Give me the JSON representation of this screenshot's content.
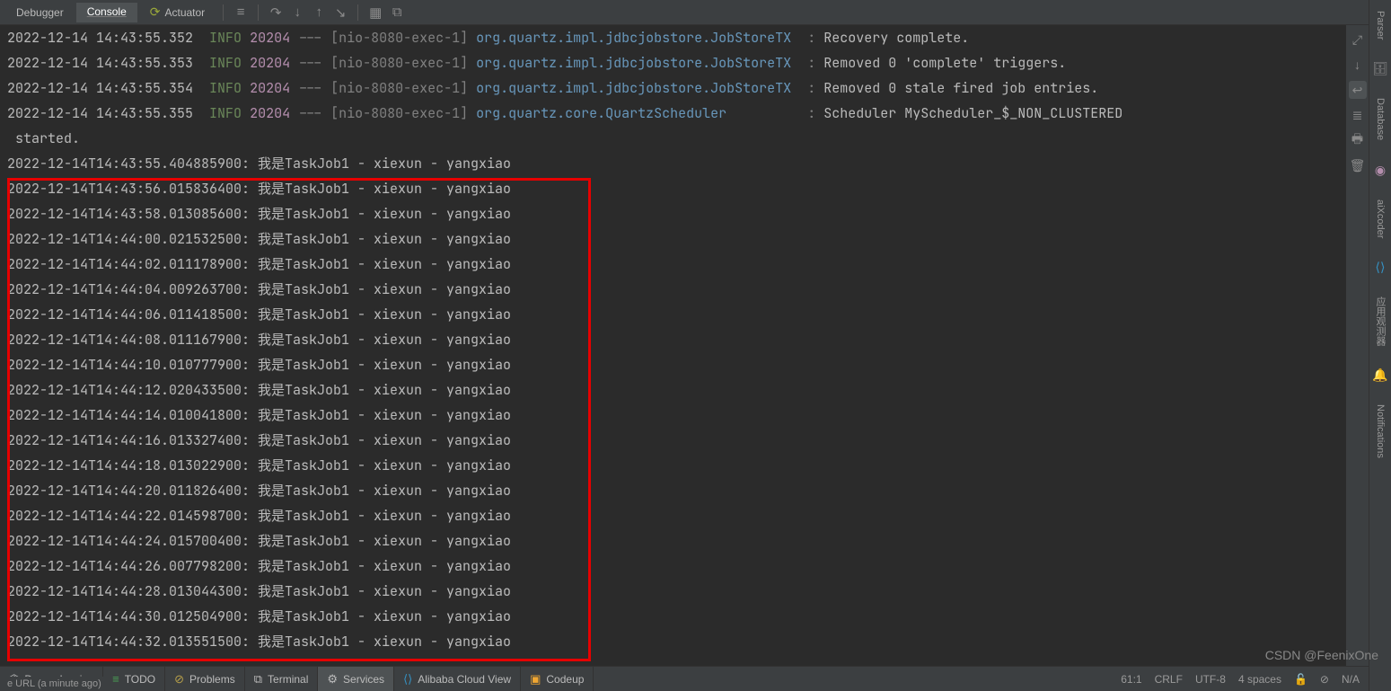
{
  "tabs": {
    "debugger": "Debugger",
    "console": "Console",
    "actuator": "Actuator"
  },
  "logs": [
    {
      "ts": "2022-12-14 14:43:55.352",
      "lvl": "INFO",
      "pid": "20204",
      "dash": "---",
      "thread": "[nio-8080-exec-1]",
      "logger": "org.quartz.impl.jdbcjobstore.JobStoreTX",
      "msg": "Recovery complete."
    },
    {
      "ts": "2022-12-14 14:43:55.353",
      "lvl": "INFO",
      "pid": "20204",
      "dash": "---",
      "thread": "[nio-8080-exec-1]",
      "logger": "org.quartz.impl.jdbcjobstore.JobStoreTX",
      "msg": "Removed 0 'complete' triggers."
    },
    {
      "ts": "2022-12-14 14:43:55.354",
      "lvl": "INFO",
      "pid": "20204",
      "dash": "---",
      "thread": "[nio-8080-exec-1]",
      "logger": "org.quartz.impl.jdbcjobstore.JobStoreTX",
      "msg": "Removed 0 stale fired job entries."
    },
    {
      "ts": "2022-12-14 14:43:55.355",
      "lvl": "INFO",
      "pid": "20204",
      "dash": "---",
      "thread": "[nio-8080-exec-1]",
      "logger": "org.quartz.core.QuartzScheduler",
      "msg": "Scheduler MyScheduler_$_NON_CLUSTERED started."
    }
  ],
  "out": [
    "2022-12-14T14:43:55.404885900: 我是TaskJob1 - xiexun - yangxiao",
    "2022-12-14T14:43:56.015836400: 我是TaskJob1 - xiexun - yangxiao",
    "2022-12-14T14:43:58.013085600: 我是TaskJob1 - xiexun - yangxiao",
    "2022-12-14T14:44:00.021532500: 我是TaskJob1 - xiexun - yangxiao",
    "2022-12-14T14:44:02.011178900: 我是TaskJob1 - xiexun - yangxiao",
    "2022-12-14T14:44:04.009263700: 我是TaskJob1 - xiexun - yangxiao",
    "2022-12-14T14:44:06.011418500: 我是TaskJob1 - xiexun - yangxiao",
    "2022-12-14T14:44:08.011167900: 我是TaskJob1 - xiexun - yangxiao",
    "2022-12-14T14:44:10.010777900: 我是TaskJob1 - xiexun - yangxiao",
    "2022-12-14T14:44:12.020433500: 我是TaskJob1 - xiexun - yangxiao",
    "2022-12-14T14:44:14.010041800: 我是TaskJob1 - xiexun - yangxiao",
    "2022-12-14T14:44:16.013327400: 我是TaskJob1 - xiexun - yangxiao",
    "2022-12-14T14:44:18.013022900: 我是TaskJob1 - xiexun - yangxiao",
    "2022-12-14T14:44:20.011826400: 我是TaskJob1 - xiexun - yangxiao",
    "2022-12-14T14:44:22.014598700: 我是TaskJob1 - xiexun - yangxiao",
    "2022-12-14T14:44:24.015700400: 我是TaskJob1 - xiexun - yangxiao",
    "2022-12-14T14:44:26.007798200: 我是TaskJob1 - xiexun - yangxiao",
    "2022-12-14T14:44:28.013044300: 我是TaskJob1 - xiexun - yangxiao",
    "2022-12-14T14:44:30.012504900: 我是TaskJob1 - xiexun - yangxiao",
    "2022-12-14T14:44:32.013551500: 我是TaskJob1 - xiexun - yangxiao"
  ],
  "bottom_tabs": {
    "deps": "Dependencies",
    "todo": "TODO",
    "problems": "Problems",
    "terminal": "Terminal",
    "services": "Services",
    "alibaba": "Alibaba Cloud View",
    "codeup": "Codeup"
  },
  "right_tabs": {
    "parser": "Parser",
    "database": "Database",
    "aixcoder": "aiXcoder",
    "appviewer": "应用观测器",
    "notifications": "Notifications"
  },
  "status": {
    "pos": "61:1",
    "eol": "CRLF",
    "enc": "UTF-8",
    "indent": "4 spaces",
    "branch_icon": "⎇",
    "na": "N/A",
    "lock": "🔓"
  },
  "watermark": "CSDN @FeenixOne",
  "url_hint": "e URL (a minute ago)"
}
